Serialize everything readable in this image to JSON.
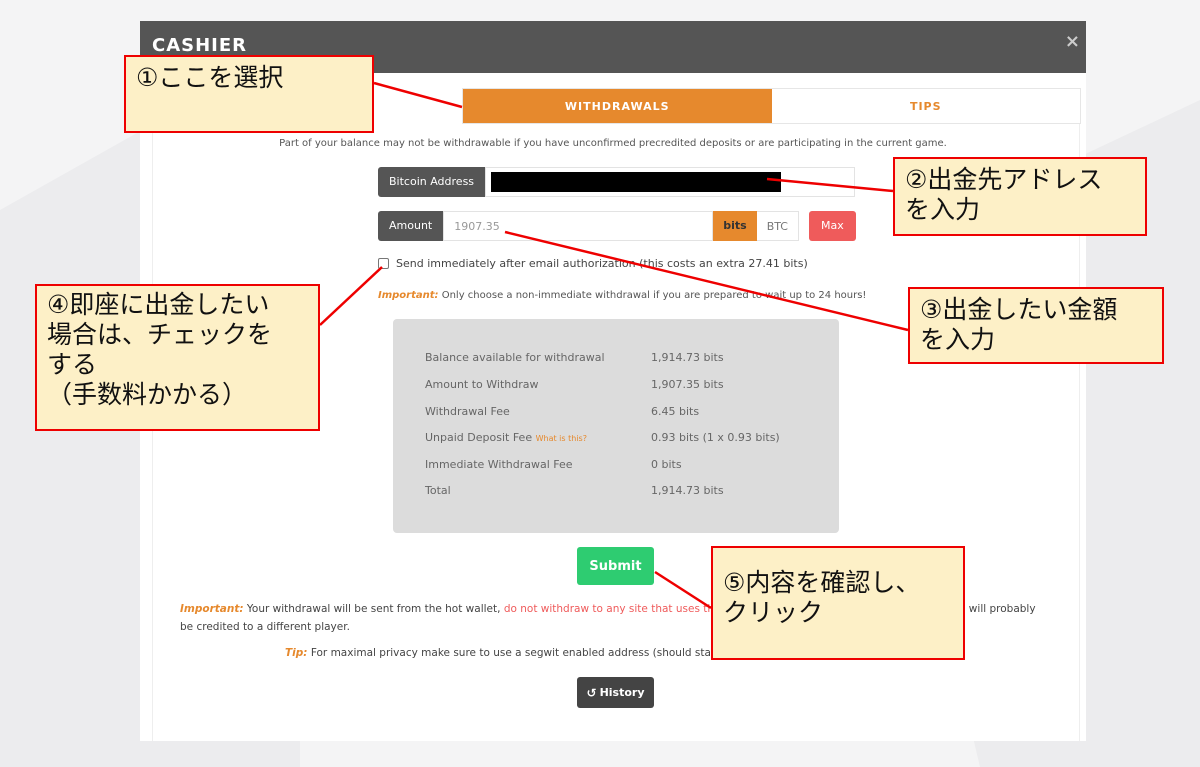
{
  "modal": {
    "title": "CASHIER",
    "close_glyph": "×"
  },
  "tabs": [
    {
      "label": "WITHDRAWALS",
      "active": true
    },
    {
      "label": "TIPS",
      "active": false
    }
  ],
  "balance_note": "Part of your balance may not be withdrawable if you have unconfirmed precredited deposits or are participating in the current game.",
  "address": {
    "label": "Bitcoin Address",
    "value": ""
  },
  "amount": {
    "label": "Amount",
    "value": "1907.35",
    "unit_bits": "bits",
    "unit_btc": "BTC",
    "max_label": "Max"
  },
  "immediate": {
    "checked": false,
    "label": "Send immediately after email authorization (this costs an extra 27.41 bits)"
  },
  "important_note": {
    "prefix": "Important:",
    "text": "Only choose a non-immediate withdrawal if you are prepared to wait up to 24 hours!"
  },
  "summary": [
    {
      "label": "Balance available for withdrawal",
      "value": "1,914.73 bits"
    },
    {
      "label": "Amount to Withdraw",
      "value": "1,907.35 bits"
    },
    {
      "label": "Withdrawal Fee",
      "value": "6.45 bits"
    },
    {
      "label": "Unpaid Deposit Fee",
      "link": "What is this?",
      "value": "0.93 bits (1 x 0.93 bits)"
    },
    {
      "label": "Immediate Withdrawal Fee",
      "value": "0 bits"
    },
    {
      "label": "Total",
      "value": "1,914.73 bits"
    }
  ],
  "submit_label": "Submit",
  "warning": {
    "prefix": "Important:",
    "text1": "Your withdrawal will be sent from the hot wallet,",
    "red": "do not withdraw to any site that uses the sending",
    "text2": "s will probably",
    "text3": "be credited to a different player."
  },
  "tip": {
    "prefix": "Tip:",
    "text": "For maximal privacy make sure to use a segwit enabled address (should start wit"
  },
  "history": {
    "icon": "↺",
    "label": "History"
  },
  "callouts": {
    "c1": "①ここを選択",
    "c2": "②出金先アドレス\nを入力",
    "c3": "③出金したい金額\nを入力",
    "c4": "④即座に出金したい\n場合は、チェックを\nする\n（手数料かかる）",
    "c5": "⑤内容を確認し、\nクリック"
  },
  "colors": {
    "accent": "#e6892d",
    "danger": "#ef5b5b",
    "success": "#2ecc71",
    "header": "#555555",
    "annotation": "#e00000"
  }
}
